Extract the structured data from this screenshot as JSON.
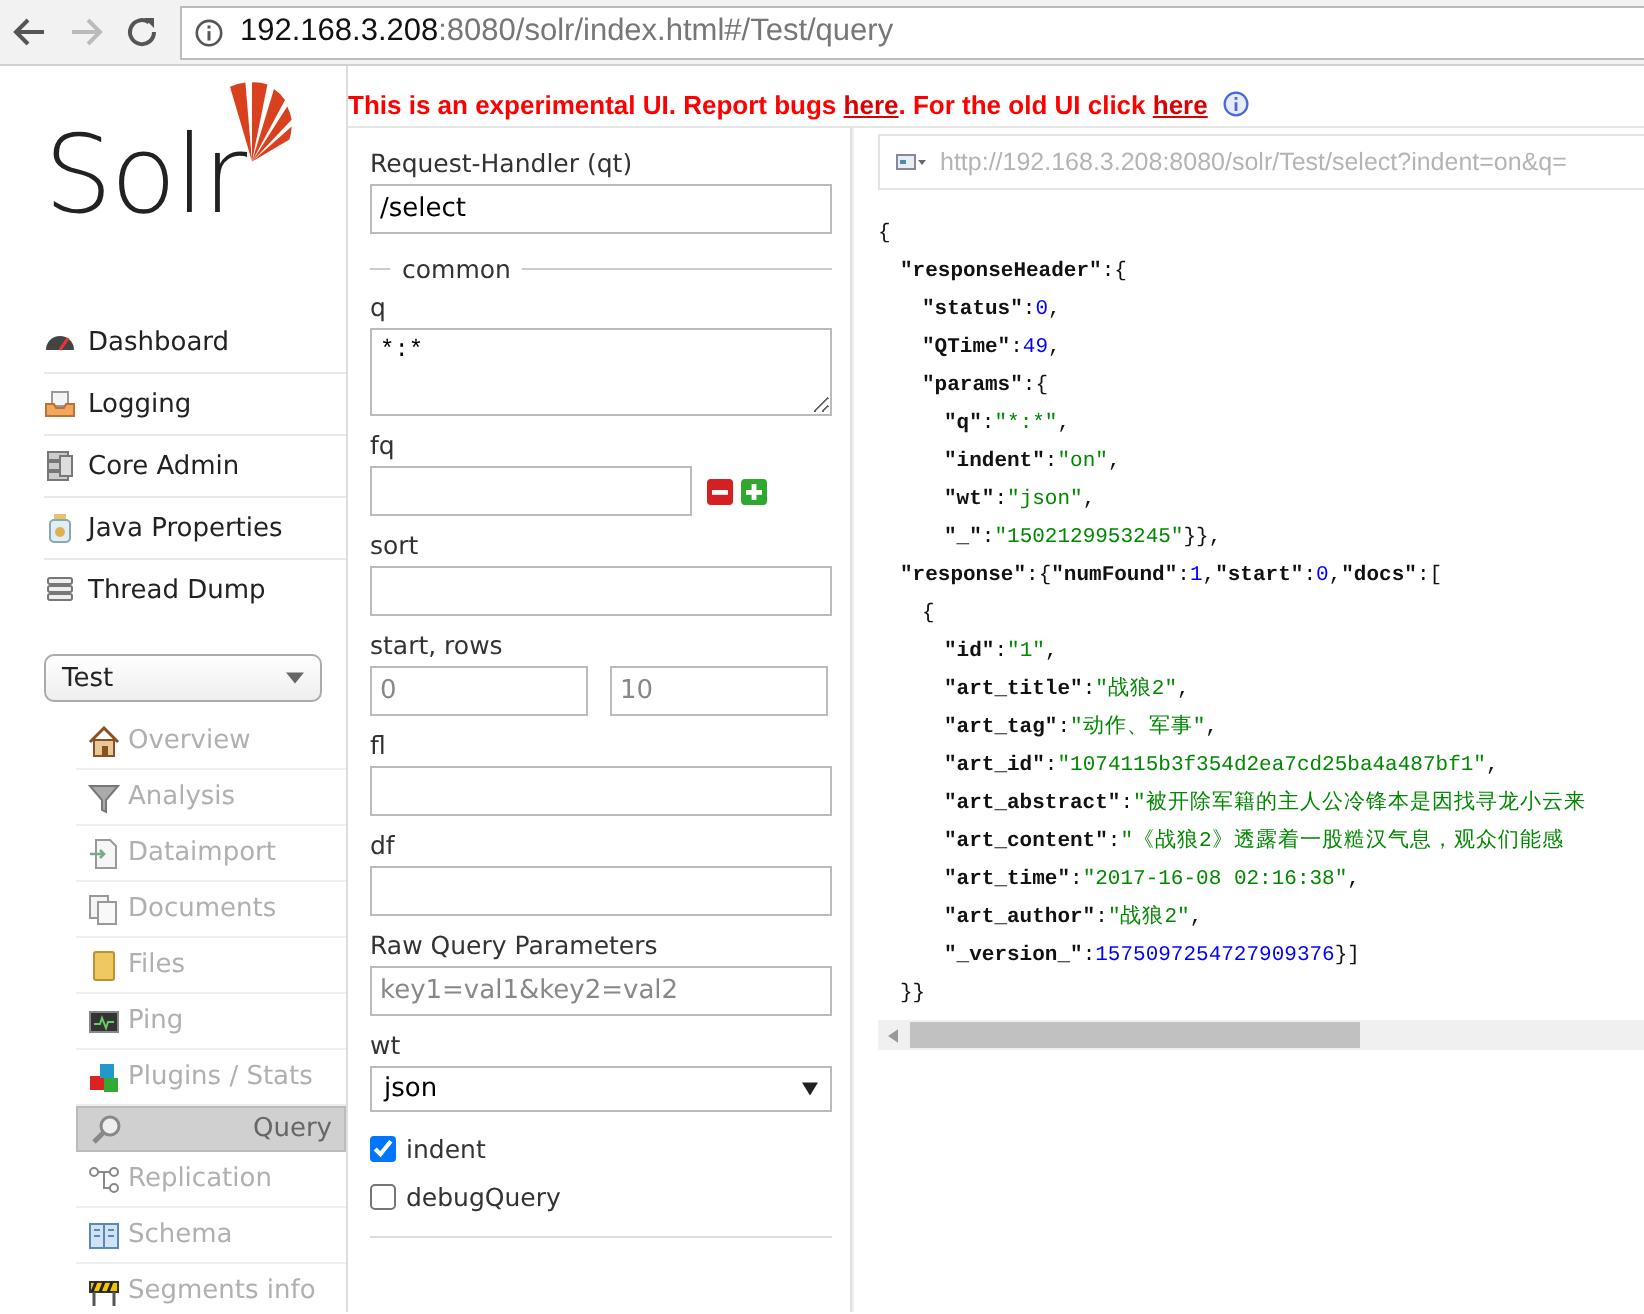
{
  "browser": {
    "url_host": "192.168.3.208",
    "url_rest": ":8080/solr/index.html#/Test/query"
  },
  "banner": {
    "text_1": "This is an experimental UI. Report bugs ",
    "link_1": "here",
    "text_2": ". For the old UI click ",
    "link_2": "here"
  },
  "logo_text": "Solr",
  "nav": [
    {
      "label": "Dashboard"
    },
    {
      "label": "Logging"
    },
    {
      "label": "Core Admin"
    },
    {
      "label": "Java Properties"
    },
    {
      "label": "Thread Dump"
    }
  ],
  "core_selector": {
    "value": "Test"
  },
  "core_menu": [
    {
      "label": "Overview",
      "selected": false
    },
    {
      "label": "Analysis",
      "selected": false
    },
    {
      "label": "Dataimport",
      "selected": false
    },
    {
      "label": "Documents",
      "selected": false
    },
    {
      "label": "Files",
      "selected": false
    },
    {
      "label": "Ping",
      "selected": false
    },
    {
      "label": "Plugins / Stats",
      "selected": false
    },
    {
      "label": "Query",
      "selected": true
    },
    {
      "label": "Replication",
      "selected": false
    },
    {
      "label": "Schema",
      "selected": false
    },
    {
      "label": "Segments info",
      "selected": false
    }
  ],
  "form": {
    "request_handler": {
      "label": "Request-Handler (qt)",
      "value": "/select"
    },
    "legend": "common",
    "q": {
      "label": "q",
      "value": "*:*"
    },
    "fq": {
      "label": "fq"
    },
    "sort": {
      "label": "sort"
    },
    "start_rows": {
      "label": "start, rows",
      "start_placeholder": "0",
      "rows_placeholder": "10"
    },
    "fl": {
      "label": "fl"
    },
    "df": {
      "label": "df"
    },
    "raw": {
      "label": "Raw Query Parameters",
      "placeholder": "key1=val1&key2=val2"
    },
    "wt": {
      "label": "wt",
      "value": "json"
    },
    "options": [
      {
        "label": "indent",
        "checked": true
      },
      {
        "label": "debugQuery",
        "checked": false
      }
    ]
  },
  "results": {
    "url": "http://192.168.3.208:8080/solr/Test/select?indent=on&q=",
    "json": [
      {
        "tokens": [
          {
            "kind": "punct",
            "text": "{"
          }
        ],
        "children": [
          {
            "tokens": [
              {
                "kind": "key",
                "text": "\"responseHeader\""
              },
              {
                "kind": "punct",
                "text": ":{"
              }
            ],
            "children": [
              {
                "tokens": [
                  {
                    "kind": "key",
                    "text": "\"status\""
                  },
                  {
                    "kind": "punct",
                    "text": ":"
                  },
                  {
                    "kind": "number",
                    "text": "0"
                  },
                  {
                    "kind": "punct",
                    "text": ","
                  }
                ]
              },
              {
                "tokens": [
                  {
                    "kind": "key",
                    "text": "\"QTime\""
                  },
                  {
                    "kind": "punct",
                    "text": ":"
                  },
                  {
                    "kind": "number",
                    "text": "49"
                  },
                  {
                    "kind": "punct",
                    "text": ","
                  }
                ]
              },
              {
                "tokens": [
                  {
                    "kind": "key",
                    "text": "\"params\""
                  },
                  {
                    "kind": "punct",
                    "text": ":{"
                  }
                ],
                "children": [
                  {
                    "tokens": [
                      {
                        "kind": "key",
                        "text": "\"q\""
                      },
                      {
                        "kind": "punct",
                        "text": ":"
                      },
                      {
                        "kind": "string",
                        "text": "\"*:*\""
                      },
                      {
                        "kind": "punct",
                        "text": ","
                      }
                    ]
                  },
                  {
                    "tokens": [
                      {
                        "kind": "key",
                        "text": "\"indent\""
                      },
                      {
                        "kind": "punct",
                        "text": ":"
                      },
                      {
                        "kind": "string",
                        "text": "\"on\""
                      },
                      {
                        "kind": "punct",
                        "text": ","
                      }
                    ]
                  },
                  {
                    "tokens": [
                      {
                        "kind": "key",
                        "text": "\"wt\""
                      },
                      {
                        "kind": "punct",
                        "text": ":"
                      },
                      {
                        "kind": "string",
                        "text": "\"json\""
                      },
                      {
                        "kind": "punct",
                        "text": ","
                      }
                    ]
                  },
                  {
                    "tokens": [
                      {
                        "kind": "key",
                        "text": "\"_\""
                      },
                      {
                        "kind": "punct",
                        "text": ":"
                      },
                      {
                        "kind": "string",
                        "text": "\"1502129953245\""
                      },
                      {
                        "kind": "punct",
                        "text": "}},"
                      }
                    ]
                  }
                ]
              }
            ]
          },
          {
            "tokens": [
              {
                "kind": "key",
                "text": "\"response\""
              },
              {
                "kind": "punct",
                "text": ":{"
              },
              {
                "kind": "key",
                "text": "\"numFound\""
              },
              {
                "kind": "punct",
                "text": ":"
              },
              {
                "kind": "number",
                "text": "1"
              },
              {
                "kind": "punct",
                "text": ","
              },
              {
                "kind": "key",
                "text": "\"start\""
              },
              {
                "kind": "punct",
                "text": ":"
              },
              {
                "kind": "number",
                "text": "0"
              },
              {
                "kind": "punct",
                "text": ","
              },
              {
                "kind": "key",
                "text": "\"docs\""
              },
              {
                "kind": "punct",
                "text": ":["
              }
            ],
            "children": [
              {
                "tokens": [
                  {
                    "kind": "punct",
                    "text": "{"
                  }
                ],
                "children": [
                  {
                    "tokens": [
                      {
                        "kind": "key",
                        "text": "\"id\""
                      },
                      {
                        "kind": "punct",
                        "text": ":"
                      },
                      {
                        "kind": "string",
                        "text": "\"1\""
                      },
                      {
                        "kind": "punct",
                        "text": ","
                      }
                    ]
                  },
                  {
                    "tokens": [
                      {
                        "kind": "key",
                        "text": "\"art_title\""
                      },
                      {
                        "kind": "punct",
                        "text": ":"
                      },
                      {
                        "kind": "string",
                        "text": "\"战狼2\""
                      },
                      {
                        "kind": "punct",
                        "text": ","
                      }
                    ]
                  },
                  {
                    "tokens": [
                      {
                        "kind": "key",
                        "text": "\"art_tag\""
                      },
                      {
                        "kind": "punct",
                        "text": ":"
                      },
                      {
                        "kind": "string",
                        "text": "\"动作、军事\""
                      },
                      {
                        "kind": "punct",
                        "text": ","
                      }
                    ]
                  },
                  {
                    "tokens": [
                      {
                        "kind": "key",
                        "text": "\"art_id\""
                      },
                      {
                        "kind": "punct",
                        "text": ":"
                      },
                      {
                        "kind": "string",
                        "text": "\"1074115b3f354d2ea7cd25ba4a487bf1\""
                      },
                      {
                        "kind": "punct",
                        "text": ","
                      }
                    ]
                  },
                  {
                    "tokens": [
                      {
                        "kind": "key",
                        "text": "\"art_abstract\""
                      },
                      {
                        "kind": "punct",
                        "text": ":"
                      },
                      {
                        "kind": "string",
                        "text": "\"被开除军籍的主人公冷锋本是因找寻龙小云来"
                      }
                    ]
                  },
                  {
                    "tokens": [
                      {
                        "kind": "key",
                        "text": "\"art_content\""
                      },
                      {
                        "kind": "punct",
                        "text": ":"
                      },
                      {
                        "kind": "string",
                        "text": "\"《战狼2》透露着一股糙汉气息，观众们能感"
                      }
                    ]
                  },
                  {
                    "tokens": [
                      {
                        "kind": "key",
                        "text": "\"art_time\""
                      },
                      {
                        "kind": "punct",
                        "text": ":"
                      },
                      {
                        "kind": "string",
                        "text": "\"2017-16-08 02:16:38\""
                      },
                      {
                        "kind": "punct",
                        "text": ","
                      }
                    ]
                  },
                  {
                    "tokens": [
                      {
                        "kind": "key",
                        "text": "\"art_author\""
                      },
                      {
                        "kind": "punct",
                        "text": ":"
                      },
                      {
                        "kind": "string",
                        "text": "\"战狼2\""
                      },
                      {
                        "kind": "punct",
                        "text": ","
                      }
                    ]
                  },
                  {
                    "tokens": [
                      {
                        "kind": "key",
                        "text": "\"_version_\""
                      },
                      {
                        "kind": "punct",
                        "text": ":"
                      },
                      {
                        "kind": "number",
                        "text": "1575097254727909376"
                      },
                      {
                        "kind": "punct",
                        "text": "}]"
                      }
                    ]
                  }
                ]
              }
            ]
          },
          {
            "tokens": [
              {
                "kind": "punct",
                "text": "}}"
              }
            ]
          }
        ]
      }
    ]
  }
}
